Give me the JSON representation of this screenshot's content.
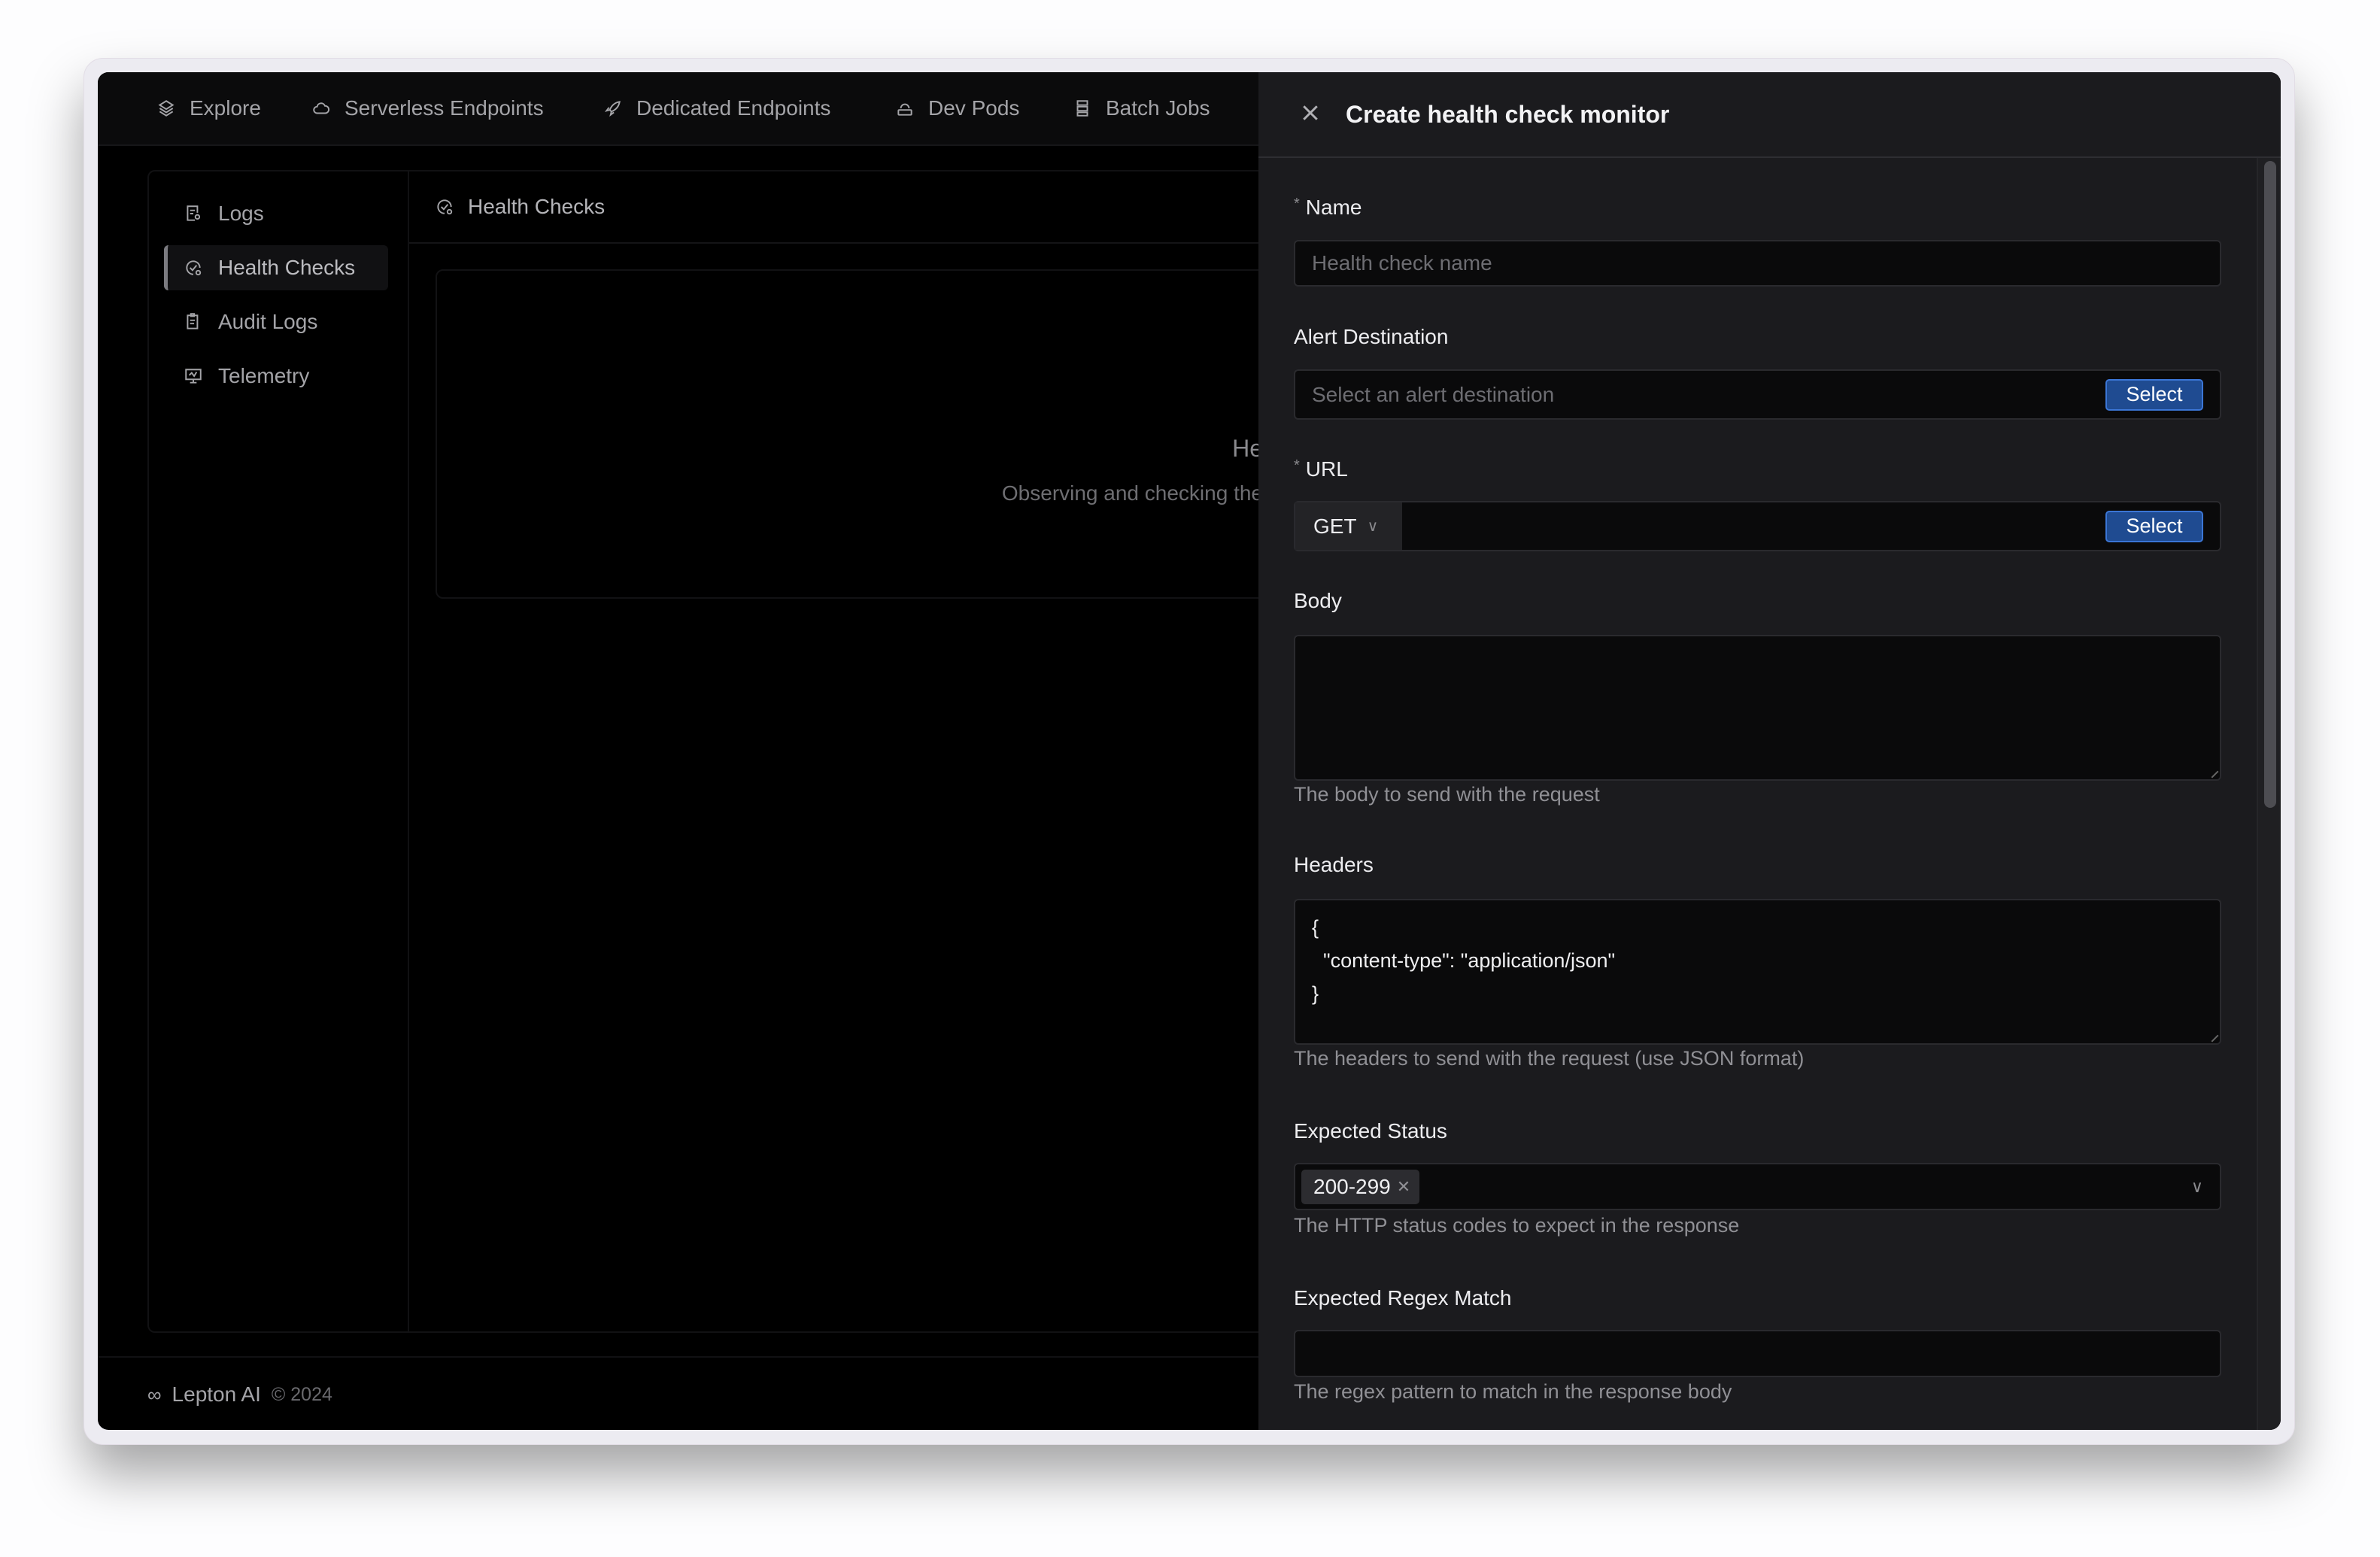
{
  "nav": {
    "items": [
      {
        "label": "Explore",
        "icon": "layers-icon"
      },
      {
        "label": "Serverless Endpoints",
        "icon": "cloud-icon"
      },
      {
        "label": "Dedicated Endpoints",
        "icon": "rocket-icon"
      },
      {
        "label": "Dev Pods",
        "icon": "pod-icon"
      },
      {
        "label": "Batch Jobs",
        "icon": "server-icon"
      }
    ]
  },
  "sidebar": {
    "items": [
      {
        "label": "Logs",
        "icon": "log-search-icon",
        "active": false
      },
      {
        "label": "Health Checks",
        "icon": "health-check-icon",
        "active": true
      },
      {
        "label": "Audit Logs",
        "icon": "clipboard-icon",
        "active": false
      },
      {
        "label": "Telemetry",
        "icon": "monitor-icon",
        "active": false
      }
    ]
  },
  "content": {
    "header": "Health Checks",
    "empty_title": "He",
    "empty_subtitle": "Observing and checking the"
  },
  "footer": {
    "brand": "Lepton AI",
    "copyright": "© 2024"
  },
  "drawer": {
    "title": "Create health check monitor",
    "name": {
      "label": "Name",
      "required": true,
      "placeholder": "Health check name",
      "value": ""
    },
    "alert": {
      "label": "Alert Destination",
      "placeholder": "Select an alert destination",
      "button": "Select"
    },
    "url": {
      "label": "URL",
      "required": true,
      "method": "GET",
      "value": "",
      "button": "Select"
    },
    "body": {
      "label": "Body",
      "value": "",
      "help": "The body to send with the request"
    },
    "headers": {
      "label": "Headers",
      "value": "{\n  \"content-type\": \"application/json\"\n}",
      "help": "The headers to send with the request (use JSON format)"
    },
    "expected_status": {
      "label": "Expected Status",
      "tags": [
        "200-299"
      ],
      "help": "The HTTP status codes to expect in the response"
    },
    "regex": {
      "label": "Expected Regex Match",
      "value": "",
      "help": "The regex pattern to match in the response body"
    }
  },
  "colors": {
    "accent": "#1f4b91",
    "accent_border": "#3b76d6",
    "drawer_bg": "#1b1b1e",
    "app_bg": "#000000"
  }
}
